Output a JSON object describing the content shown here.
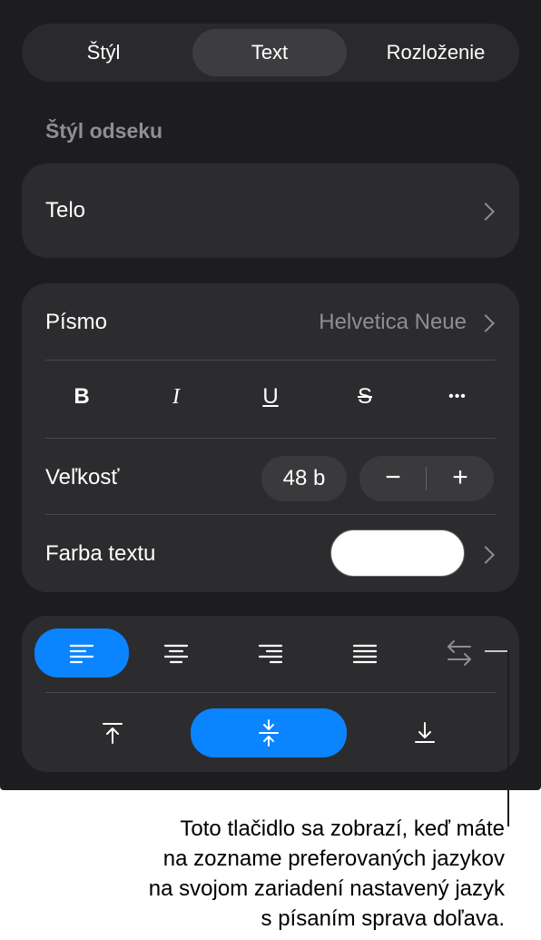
{
  "tabs": [
    {
      "label": "Štýl",
      "active": false
    },
    {
      "label": "Text",
      "active": true
    },
    {
      "label": "Rozloženie",
      "active": false
    }
  ],
  "paragraph_style": {
    "section_title": "Štýl odseku",
    "value": "Telo"
  },
  "font": {
    "label": "Písmo",
    "value": "Helvetica Neue",
    "format_buttons": [
      {
        "icon": "bold-icon",
        "glyph": "B"
      },
      {
        "icon": "italic-icon",
        "glyph": "I"
      },
      {
        "icon": "underline-icon",
        "glyph": "U"
      },
      {
        "icon": "strikethrough-icon",
        "glyph": "S"
      },
      {
        "icon": "more-icon",
        "glyph": "•••"
      }
    ]
  },
  "size": {
    "label": "Veľkosť",
    "value": "48 b",
    "decrement": "−",
    "increment": "+"
  },
  "text_color": {
    "label": "Farba textu",
    "color": "#ffffff"
  },
  "alignment": {
    "horizontal": [
      {
        "icon": "align-left-icon",
        "active": true
      },
      {
        "icon": "align-center-icon",
        "active": false
      },
      {
        "icon": "align-right-icon",
        "active": false
      },
      {
        "icon": "align-justify-icon",
        "active": false
      },
      {
        "icon": "text-direction-icon",
        "active": false
      }
    ],
    "vertical": [
      {
        "icon": "align-top-icon",
        "active": false
      },
      {
        "icon": "align-middle-icon",
        "active": true
      },
      {
        "icon": "align-bottom-icon",
        "active": false
      }
    ]
  },
  "callout": {
    "lines": [
      "Toto tlačidlo sa zobrazí, keď máte",
      "na zozname preferovaných jazykov",
      "na svojom zariadení nastavený jazyk",
      "s písaním sprava doľava."
    ]
  },
  "colors": {
    "panel_bg": "#1d1d1f",
    "card_bg": "#2c2c2e",
    "accent": "#0a84ff"
  }
}
